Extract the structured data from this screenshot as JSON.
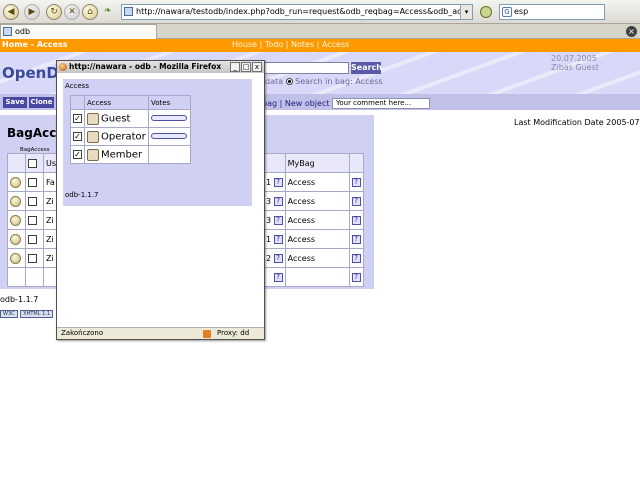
{
  "browser": {
    "url": "http://nawara/testodb/index.php?odb_run=request&odb_reqbag=Access&odb_access=3&",
    "search_text": "esp",
    "search_engine_glyph": "G",
    "tab_title": "odb",
    "icons": [
      "back-icon",
      "forward-icon",
      "reload-icon",
      "stop-icon",
      "home-icon",
      "go-icon",
      "close-tab-icon"
    ]
  },
  "page": {
    "breadcrumb": "Home - Access",
    "top_links": "House | Todo | Notes | Access",
    "logo": "OpenD",
    "date": "20.07.2005",
    "user": "Zibas Guest",
    "search_button": "Search",
    "search_options_text": "ll data",
    "search_in_bag": "Search in bag: Access",
    "actions": {
      "save": "Save",
      "clone": "Clone",
      "links": "bag | New object |",
      "comment_placeholder": "Your comment here..."
    },
    "bag_title": "BagAcc",
    "last_modified": "Last Modification Date 2005-07-20",
    "table": {
      "header_small": "BagAccess",
      "col_user": "Us",
      "col_mybag": "MyBag",
      "rows": [
        {
          "name": "Fa",
          "num": "1",
          "bag": "Access"
        },
        {
          "name": "Zi",
          "num": "3",
          "bag": "Access"
        },
        {
          "name": "Zi",
          "num": "3",
          "bag": "Access"
        },
        {
          "name": "Zi",
          "num": "1",
          "bag": "Access"
        },
        {
          "name": "Zi",
          "num": "2",
          "bag": "Access"
        }
      ]
    },
    "version": "odb-1.1.7",
    "badges": [
      "W3C",
      "XHTML 1.1"
    ]
  },
  "popup": {
    "title": "http://nawara - odb - Mozilla Firefox",
    "window_buttons": [
      "_",
      "□",
      "x"
    ],
    "panel_label": "Access",
    "col_access": "Access",
    "col_votes": "Votes",
    "roles": [
      {
        "label": "Guest",
        "checked": "✓"
      },
      {
        "label": "Operator",
        "checked": "✓"
      },
      {
        "label": "Member",
        "checked": "✓"
      }
    ],
    "version": "odb-1.1.7",
    "status_text": "Zakończono",
    "proxy_text": "Proxy: dd"
  },
  "colors": {
    "accent_orange": "#ff9900",
    "panel_lavender": "#d0d0f4",
    "button_blue": "#4848a0"
  }
}
